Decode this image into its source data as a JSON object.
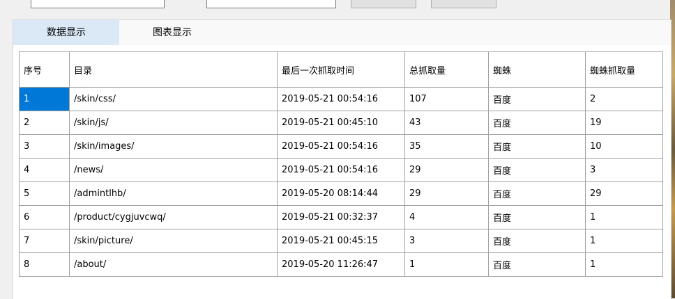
{
  "tabs": [
    {
      "label": "数据显示",
      "active": true
    },
    {
      "label": "图表显示",
      "active": false
    }
  ],
  "table": {
    "columns": [
      "序号",
      "目录",
      "最后一次抓取时间",
      "总抓取量",
      "蜘蛛",
      "蜘蛛抓取量"
    ],
    "rows": [
      [
        "1",
        "/skin/css/",
        "2019-05-21 00:54:16",
        "107",
        "百度",
        "2"
      ],
      [
        "2",
        "/skin/js/",
        "2019-05-21 00:45:10",
        "43",
        "百度",
        "19"
      ],
      [
        "3",
        "/skin/images/",
        "2019-05-21 00:54:16",
        "35",
        "百度",
        "10"
      ],
      [
        "4",
        "/news/",
        "2019-05-21 00:54:16",
        "29",
        "百度",
        "3"
      ],
      [
        "5",
        "/admintlhb/",
        "2019-05-20 08:14:44",
        "29",
        "百度",
        "29"
      ],
      [
        "6",
        "/product/cygjuvcwq/",
        "2019-05-21 00:32:37",
        "4",
        "百度",
        "1"
      ],
      [
        "7",
        "/skin/picture/",
        "2019-05-21 00:45:15",
        "3",
        "百度",
        "1"
      ],
      [
        "8",
        "/about/",
        "2019-05-20 11:26:47",
        "1",
        "百度",
        "1"
      ]
    ],
    "selected_cell": {
      "row": 0,
      "col": 0
    }
  },
  "colors": {
    "selection": "#0078d7",
    "active_tab": "#dbe8f6",
    "grid_border": "#a0a0a0"
  }
}
